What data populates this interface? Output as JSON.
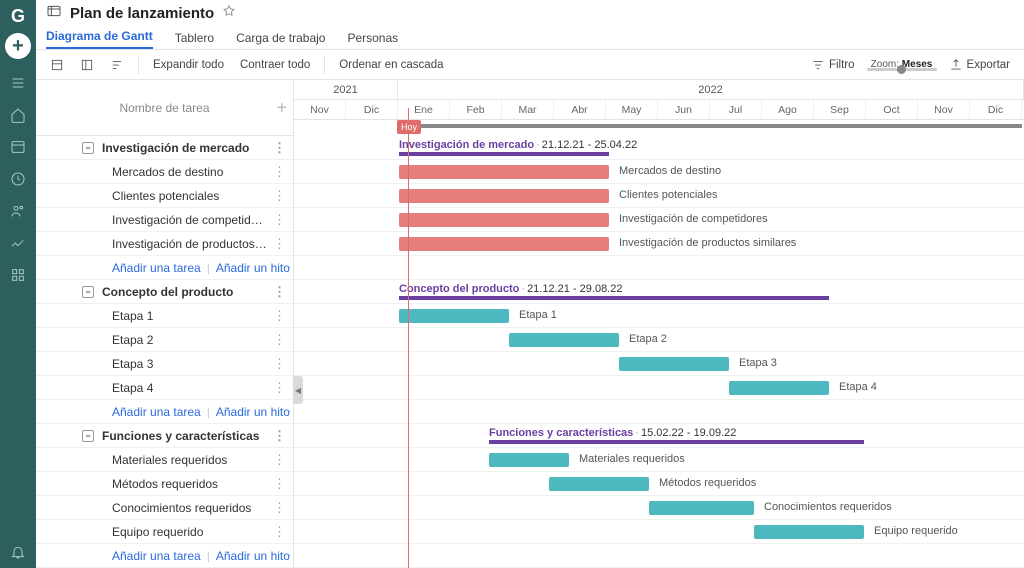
{
  "header": {
    "title": "Plan de lanzamiento"
  },
  "tabs": {
    "gantt": "Diagrama de Gantt",
    "board": "Tablero",
    "workload": "Carga de trabajo",
    "people": "Personas"
  },
  "toolbar": {
    "expand_all": "Expandir todo",
    "collapse_all": "Contraer todo",
    "cascade": "Ordenar en cascada",
    "filter": "Filtro",
    "zoom_label": "Zoom:",
    "zoom_value": "Meses",
    "export": "Exportar"
  },
  "tasklist": {
    "header": "Nombre de tarea",
    "add_task": "Añadir una tarea",
    "add_milestone": "Añadir un hito"
  },
  "timeline": {
    "years": [
      "2021",
      "2022"
    ],
    "months": [
      "Nov",
      "Dic",
      "Ene",
      "Feb",
      "Mar",
      "Abr",
      "May",
      "Jun",
      "Jul",
      "Ago",
      "Sep",
      "Oct",
      "Nov",
      "Dic"
    ],
    "today": "Hoy"
  },
  "groups": {
    "g1": {
      "name": "Investigación de mercado",
      "dates": "21.12.21 - 25.04.22",
      "tasks": [
        "Mercados de destino",
        "Clientes potenciales",
        "Investigación de competidores",
        "Investigación de productos similares"
      ],
      "task4_short": "Investigación de productos si..."
    },
    "g2": {
      "name": "Concepto del producto",
      "dates": "21.12.21 - 29.08.22",
      "tasks": [
        "Etapa 1",
        "Etapa 2",
        "Etapa 3",
        "Etapa 4"
      ]
    },
    "g3": {
      "name": "Funciones y características",
      "dates": "15.02.22 - 19.09.22",
      "tasks": [
        "Materiales requeridos",
        "Métodos requeridos",
        "Conocimientos requeridos",
        "Equipo requerido"
      ]
    }
  },
  "chart_data": {
    "type": "gantt",
    "time_axis": {
      "unit": "month",
      "start": "2021-11",
      "end": "2022-12"
    },
    "today": "2022-01-05",
    "groups": [
      {
        "name": "Investigación de mercado",
        "start": "2021-12-21",
        "end": "2022-04-25",
        "tasks": [
          {
            "name": "Mercados de destino",
            "start": "2021-12-21",
            "end": "2022-04-25",
            "color": "#e77d7d"
          },
          {
            "name": "Clientes potenciales",
            "start": "2021-12-21",
            "end": "2022-04-25",
            "color": "#e77d7d"
          },
          {
            "name": "Investigación de competidores",
            "start": "2021-12-21",
            "end": "2022-04-25",
            "color": "#e77d7d"
          },
          {
            "name": "Investigación de productos similares",
            "start": "2021-12-21",
            "end": "2022-04-25",
            "color": "#e77d7d"
          }
        ]
      },
      {
        "name": "Concepto del producto",
        "start": "2021-12-21",
        "end": "2022-08-29",
        "tasks": [
          {
            "name": "Etapa 1",
            "start": "2021-12-21",
            "end": "2022-02-28",
            "color": "#4db8c0"
          },
          {
            "name": "Etapa 2",
            "start": "2022-02-28",
            "end": "2022-04-30",
            "color": "#4db8c0"
          },
          {
            "name": "Etapa 3",
            "start": "2022-04-30",
            "end": "2022-06-30",
            "color": "#4db8c0"
          },
          {
            "name": "Etapa 4",
            "start": "2022-06-30",
            "end": "2022-08-29",
            "color": "#4db8c0"
          }
        ]
      },
      {
        "name": "Funciones y características",
        "start": "2022-02-15",
        "end": "2022-09-19",
        "tasks": [
          {
            "name": "Materiales requeridos",
            "start": "2022-02-15",
            "end": "2022-03-31",
            "color": "#4db8c0"
          },
          {
            "name": "Métodos requeridos",
            "start": "2022-03-15",
            "end": "2022-05-15",
            "color": "#4db8c0"
          },
          {
            "name": "Conocimientos requeridos",
            "start": "2022-05-15",
            "end": "2022-07-15",
            "color": "#4db8c0"
          },
          {
            "name": "Equipo requerido",
            "start": "2022-07-15",
            "end": "2022-09-19",
            "color": "#4db8c0"
          }
        ]
      }
    ]
  }
}
